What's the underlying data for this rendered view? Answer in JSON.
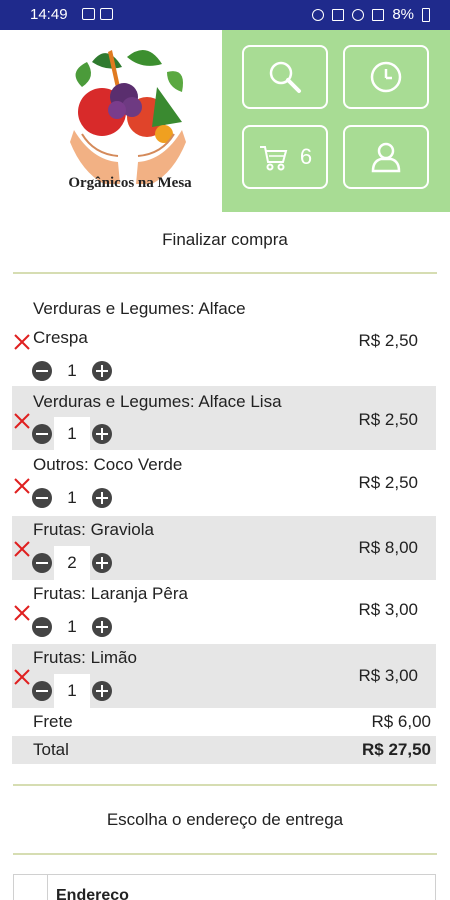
{
  "status_bar": {
    "time": "14:49",
    "battery": "8%"
  },
  "logo": {
    "text": "Orgânicos na Mesa"
  },
  "actions": {
    "cart_count": "6"
  },
  "checkout": {
    "title": "Finalizar compra",
    "items": [
      {
        "name_line1": "Verduras e Legumes: Alface",
        "name_line2": "Crespa",
        "qty": "1",
        "price": "R$ 2,50"
      },
      {
        "name_line1": "Verduras e Legumes: Alface Lisa",
        "qty": "1",
        "price": "R$ 2,50"
      },
      {
        "name_line1": "Outros: Coco Verde",
        "qty": "1",
        "price": "R$ 2,50"
      },
      {
        "name_line1": "Frutas: Graviola",
        "qty": "2",
        "price": "R$ 8,00"
      },
      {
        "name_line1": "Frutas: Laranja Pêra",
        "qty": "1",
        "price": "R$ 3,00"
      },
      {
        "name_line1": "Frutas: Limão",
        "qty": "1",
        "price": "R$ 3,00"
      }
    ],
    "shipping": {
      "label": "Frete",
      "value": "R$ 6,00"
    },
    "total": {
      "label": "Total",
      "value": "R$ 27,50"
    }
  },
  "delivery": {
    "title": "Escolha o endereço de entrega",
    "table_header": "Endereço"
  },
  "colors": {
    "status_bar": "#1f2a8c",
    "accent_green": "#a8dc94",
    "remove_red": "#e02020",
    "divider": "#d6ddb2"
  }
}
